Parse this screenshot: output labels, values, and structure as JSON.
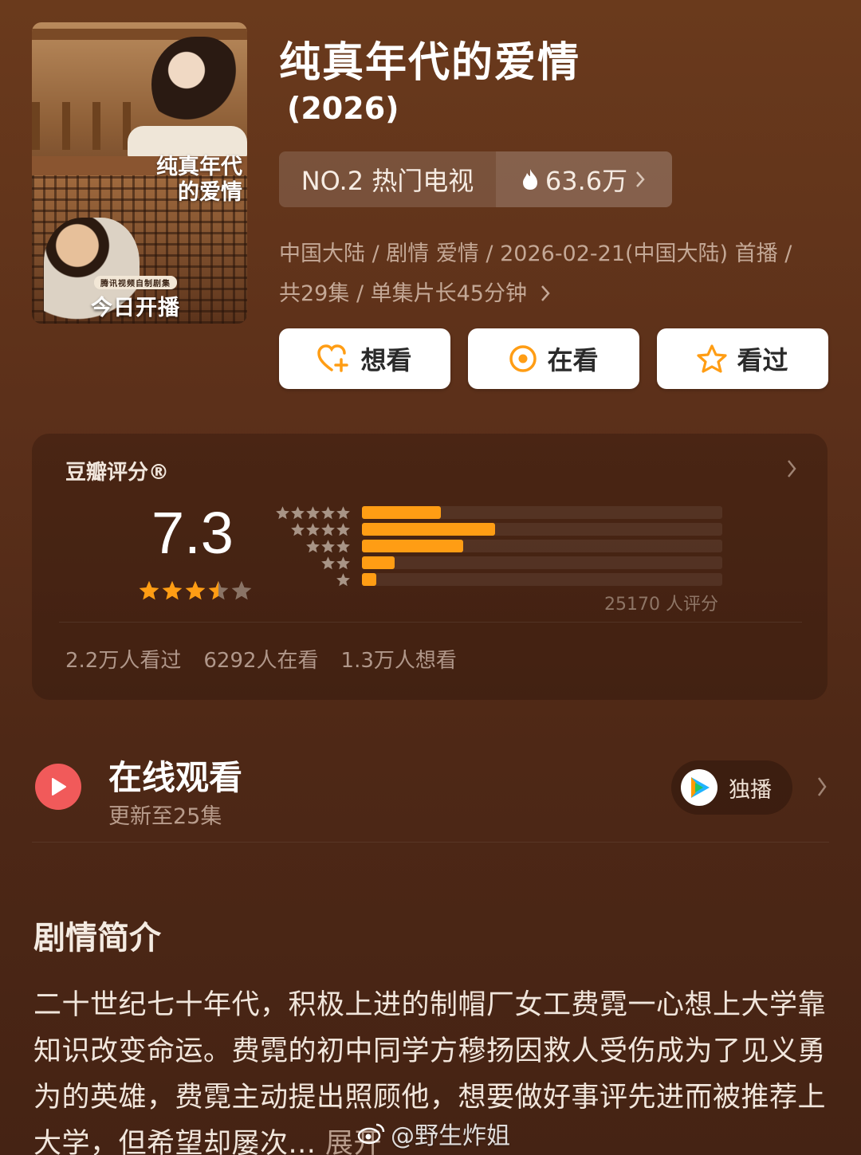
{
  "poster": {
    "title": "纯真年代的爱情",
    "tag": "腾讯视频自制剧集",
    "badge": "今日开播"
  },
  "title": "纯真年代的爱情",
  "year": "(2026)",
  "rank": {
    "label": "NO.2 热门电视",
    "heat": "63.6万"
  },
  "meta": {
    "line1": "中国大陆 / 剧情 爱情 / 2026-02-21(中国大陆) 首播 /",
    "line2": "共29集 / 单集片长45分钟"
  },
  "actions": {
    "want": "想看",
    "watching": "在看",
    "watched": "看过"
  },
  "rating": {
    "title": "豆瓣评分®",
    "score": "7.3",
    "stars": 3.5,
    "distribution": [
      {
        "stars": 5,
        "fraction": 0.22
      },
      {
        "stars": 4,
        "fraction": 0.37
      },
      {
        "stars": 3,
        "fraction": 0.28
      },
      {
        "stars": 2,
        "fraction": 0.09
      },
      {
        "stars": 1,
        "fraction": 0.04
      }
    ],
    "count": "25170 人评分",
    "watched": "2.2万人看过",
    "watching": "6292人在看",
    "want": "1.3万人想看"
  },
  "online": {
    "title": "在线观看",
    "subtitle": "更新至25集",
    "badge": "独播"
  },
  "synopsis": {
    "title": "剧情简介",
    "text": "二十世纪七十年代，积极上进的制帽厂女工费霓一心想上大学靠知识改变命运。费霓的初中同学方穆扬因救人受伤成为了见义勇为的英雄，费霓主动提出照顾他，想要做好事评先进而被推荐上大学，但希望却屡次...",
    "more": "展开"
  },
  "watermark": "@野生炸姐",
  "colors": {
    "accent": "#ff9d14",
    "heart": "#ff9d14",
    "play": "#f15a5a"
  }
}
